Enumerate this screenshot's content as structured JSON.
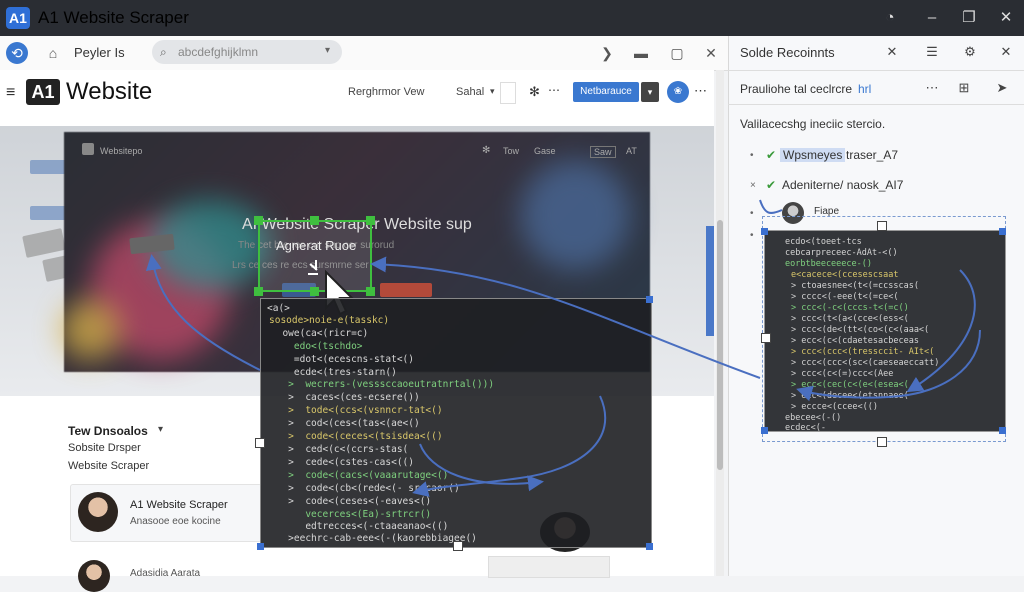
{
  "app": {
    "logo": "A1",
    "title": "A1 Website Scraper"
  },
  "window_controls": [
    "◔",
    "–",
    "❐",
    "✕"
  ],
  "browser": {
    "tab_label": "Peyler Is",
    "address_placeholder": "abcdefghijklmn",
    "controls": [
      "❯",
      "▬",
      "▢",
      "✕"
    ]
  },
  "site": {
    "logo": "A1",
    "name": "Website",
    "nav": [
      "Rerghrmor Vew",
      "Sahal"
    ],
    "primary_button": "Netbarauce",
    "hero": {
      "small": "Websitepo",
      "small_right": [
        "Tow",
        "Gase",
        "Saw",
        "AT"
      ],
      "title": "AI Website Scraper Website sup",
      "sub1": "The cet bre res cur sup cer surorud",
      "sub2": "Lrs ce ces re ecs sursmrne ser"
    },
    "selection_label": "Agnerat Ruoe",
    "list": {
      "heading": "Tew Dnsoalos",
      "item1": "Sobsite Drsper",
      "item2": "Website Scraper",
      "card_title": "A1 Website Scraper",
      "card_sub": "Anasooe eoe kocine",
      "footer_item": "Adasidia Aarata"
    }
  },
  "code_main": [
    "<a(>",
    "sosode>noie-e(tasskc)",
    "  owe(ca<(ricr=c)",
    "    edo<(tschdo>",
    "    =dot<(ecescns-stat<()",
    "    ecde<(tres-starn()",
    "   >  wecrers-(vesssccaoeutratnrtal()))",
    "   >  caces<(ces-ecsere())",
    "   >  tode<(ccs<(vsnncr-tat<()",
    "   >  cod<(ces<(tas<(ae<()",
    "   >  code<(ceces<(tsisdea<(()",
    "   >  ced<(c<(ccrs-stas(",
    "   >  cede<(cstes-cas<(()",
    "   >  code<(cacs<(vaaarutage<()",
    "   >  code<(cb<(rede<(- srccaor()",
    "   >  code<(ceses<(-eaves<()",
    "      vecerces<(Ea)-srtrcr()",
    "      edtrecces<(-ctaaeanao<(()",
    "   >eechrc-cab-eee<(-(kaorebbiagee()"
  ],
  "right_panel": {
    "title": "Solde Recoinnts",
    "subtitle": "Prauliohe tal ceclrcre",
    "subtitle_link": "hrl",
    "desc": "Valilacecshg ineciic stercio.",
    "items": [
      {
        "mark": "•",
        "check": "✔",
        "label": "Wpsmeyes",
        "rest": "traser_A7"
      },
      {
        "mark": "×",
        "check": "✔",
        "label": "Adeniterne/ naosk_AI7",
        "rest": ""
      },
      {
        "mark": "•",
        "check": "",
        "label": "Fiape",
        "rest": ""
      },
      {
        "mark": "•",
        "check": "",
        "label": "",
        "rest": ""
      }
    ],
    "code": [
      "ecdo<(toeet-tcs",
      "cebcarpreceec-AdAt-<()",
      "eorbtbeeceeece-()",
      "e<cacece<(ccesescsaat",
      "> ctoaesnee<(t<(=ccsscas(",
      "> cccc<(-eee(t<(=ce<(",
      "> ccc<(-c<(cccs-t<(=c()",
      "> ccc<(t<(a<(cce<(ess<(",
      "> ccc<(de<(tt<(co<(c<(aaa<(",
      "> ecc<(c<(cdaetesacbeceas",
      "> ccc<(ccc<(tressccit- AIt<(",
      "> ccc<(ccc<(sc<(caeseaeccatt)",
      "> ccc<(c<(=)ccc<(Aee",
      "> ecc<(cec(c<(e<(esea<(",
      "> ecc<(decee<(etsnnaee(",
      "> eccce<(ccee<(()",
      "ebecee<(-()",
      "ecdec<(-"
    ]
  },
  "colors": {
    "accent": "#3a78d0",
    "selection": "#3fbf3f",
    "titlebar": "#2a2d33"
  }
}
